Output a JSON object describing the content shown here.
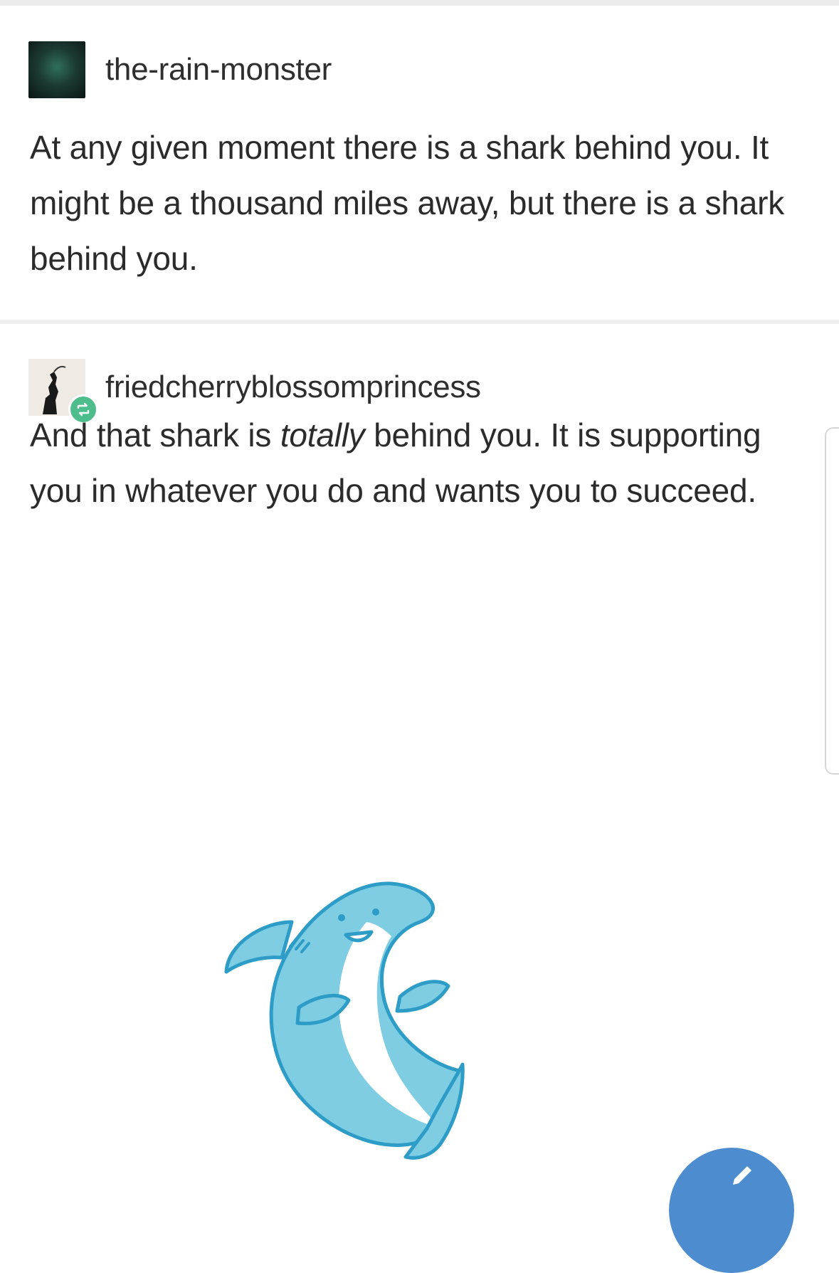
{
  "posts": [
    {
      "username": "the-rain-monster",
      "avatar": "avatar-dark-green",
      "text": "At any given moment there is a shark behind you. It might be a thousand miles away, but there is a shark behind you."
    },
    {
      "username": "friedcherryblossomprincess",
      "avatar": "avatar-silhouette",
      "badge_icon": "reblog-icon",
      "text_before": "And that shark is ",
      "text_emphasis": "totally",
      "text_after": " behind you. It is supporting you in whatever you do and wants you to succeed."
    }
  ],
  "image": {
    "icon": "shark-illustration"
  },
  "fab": {
    "icon": "pencil-icon"
  },
  "colors": {
    "reblog_badge": "#4dbd8b",
    "fab": "#4d8dcf",
    "shark_body": "#7fcde3",
    "shark_outline": "#2d9cc6"
  }
}
